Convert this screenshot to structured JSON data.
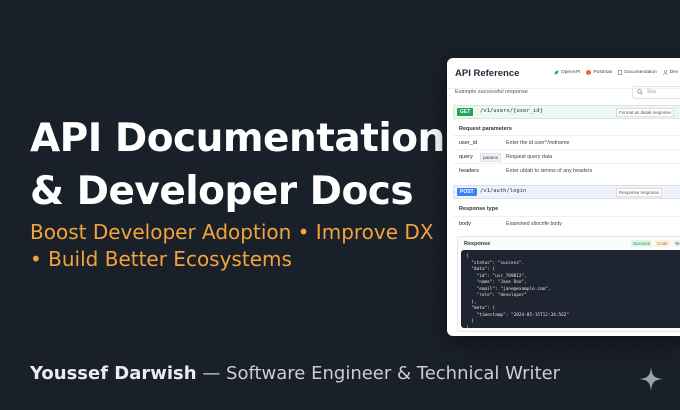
{
  "hero": {
    "title_line1": "API Documentation",
    "title_line2": "& Developer Docs",
    "tagline_line1": "Boost Developer Adoption • Improve DX",
    "tagline_line2": "• Build Better Ecosystems"
  },
  "byline": {
    "author": "Youssef Darwish",
    "role": " — Software Engineer & Technical Writer"
  },
  "colors": {
    "accent": "#f2a43a",
    "background": "#1a2029",
    "get": "#22a45d",
    "post": "#3b82f6"
  },
  "panel": {
    "title": "API Reference",
    "nav": [
      {
        "label": "OpenAPI",
        "icon": "openapi-leaf-icon"
      },
      {
        "label": "Postman",
        "icon": "postman-icon"
      },
      {
        "label": "Documentation",
        "icon": "document-icon"
      },
      {
        "label": "Dev",
        "icon": "user-icon"
      }
    ],
    "subtitle": "Example successful response",
    "search_placeholder": "Sea",
    "get_endpoint": {
      "method": "GET",
      "path": "/v1/users/{user_id}",
      "tag": "Format as detail response"
    },
    "request_params_title": "Request parameters",
    "params": [
      {
        "name": "user_id",
        "type": "",
        "desc": "Enter the id user^/mdname"
      },
      {
        "name": "query",
        "type": "params",
        "desc": "Request query data"
      },
      {
        "name": "headers",
        "type": "",
        "desc": "Enter ublab to simms of any headers"
      }
    ],
    "post_endpoint": {
      "method": "POST",
      "path": "/v1/auth/login",
      "tag": "Response response"
    },
    "response_type_title": "Response type",
    "body_row": {
      "name": "body",
      "desc": "Examined sliocrife body"
    },
    "response": {
      "label": "Response",
      "chips": [
        "Success",
        "Code",
        "Te"
      ],
      "code_lines": [
        "{",
        "  \"status\": \"success\",",
        "  \"data\": {",
        "    \"id\": \"usr_789012\",",
        "    \"name\": \"Jane Doe\",",
        "    \"email\": \"jane@example.com\",",
        "    \"role\": \"developer\"",
        "  },",
        "  \"meta\": {",
        "    \"timestamp\": \"2024-05-15T12:34:56Z\"",
        "  }",
        "}"
      ]
    }
  }
}
